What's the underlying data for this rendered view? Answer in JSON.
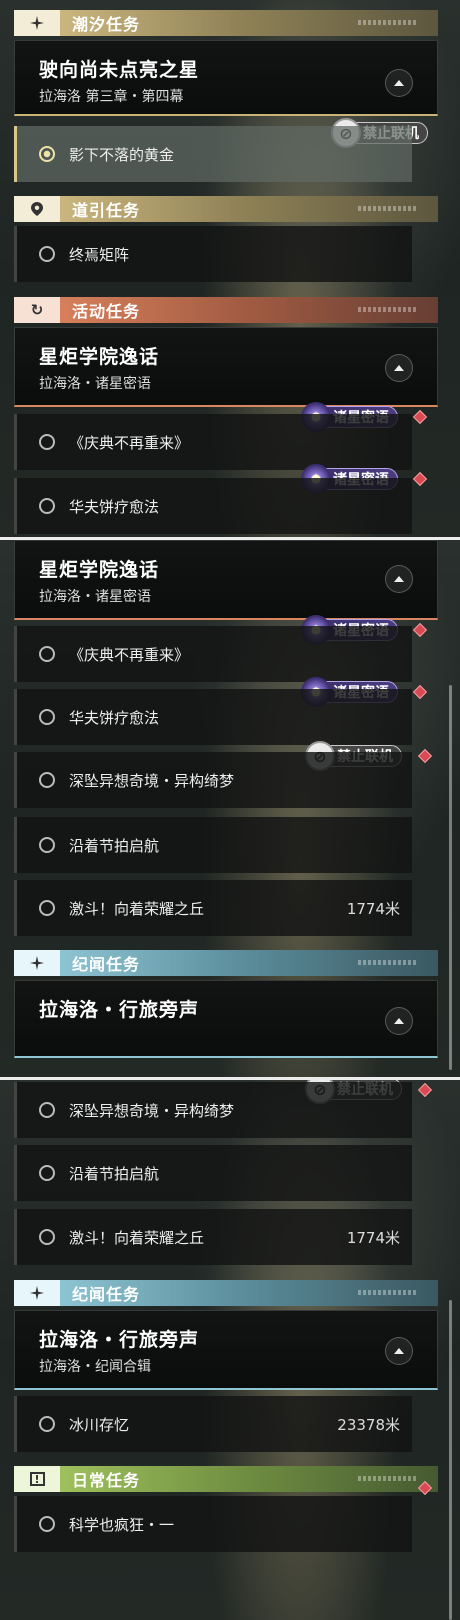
{
  "sections": {
    "tide": "潮汐任务",
    "guide": "道引任务",
    "event": "活动任务",
    "chronicle": "纪闻任务",
    "daily": "日常任务"
  },
  "cards": {
    "main": {
      "title": "驶向尚未点亮之星",
      "subtitle": "拉海洛 第三章・第四幕"
    },
    "academy": {
      "title": "星炬学院逸话",
      "subtitle": "拉海洛・诸星密语"
    },
    "travel": {
      "title": "拉海洛・行旅旁声",
      "subtitle": "拉海洛・纪闻合辑"
    }
  },
  "quests": {
    "gold": "影下不落的黄金",
    "matrix": "终焉矩阵",
    "festival": "《庆典不再重来》",
    "waffle": "华夫饼疗愈法",
    "dream": "深坠异想奇境・异构绮梦",
    "rhythm": "沿着节拍启航",
    "fight": "激斗！向着荣耀之丘",
    "fight_dist": "1774米",
    "glacier": "冰川存忆",
    "glacier_dist": "23378米",
    "science": "科学也疯狂・一"
  },
  "tags": {
    "no_coop": "禁止联机",
    "whisper": "诸星密语"
  },
  "icons": {
    "tide": "sparkle-icon",
    "guide": "location-pin-icon",
    "event": "refresh-icon",
    "chronicle": "sparkle-icon",
    "daily": "exclamation-icon",
    "ban": "no-multiplayer-icon",
    "star": "star-badge-icon",
    "diamond": "red-diamond-icon"
  },
  "colors": {
    "tide": "#d9c387",
    "event": "#e48861",
    "chronicle": "#9ad2e0",
    "daily": "#aacd63",
    "alert": "#d94a55"
  }
}
